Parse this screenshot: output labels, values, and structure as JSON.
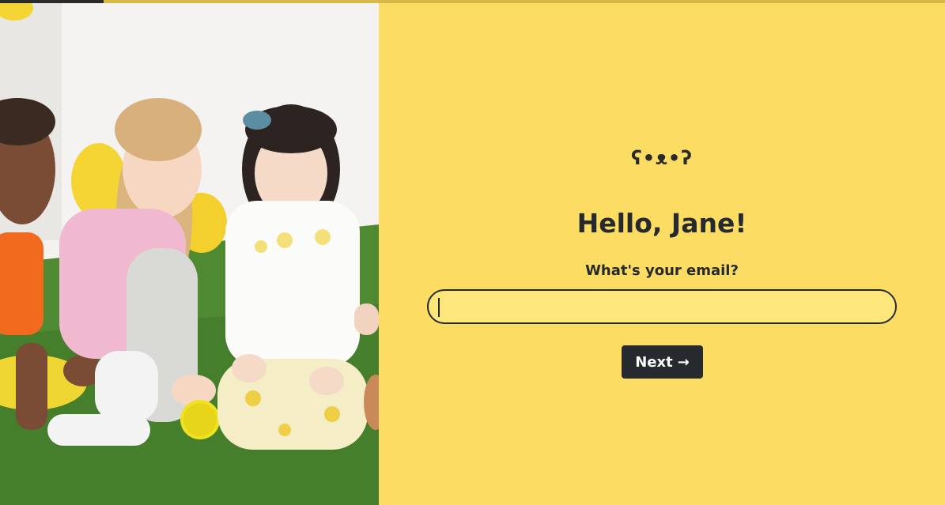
{
  "progress": {
    "fraction": 0.11
  },
  "logo": {
    "text": "ʕ•ᴥ•ʔ"
  },
  "greeting": "Hello, Jane!",
  "question": "What's your email?",
  "email": {
    "value": "",
    "placeholder": ""
  },
  "next": {
    "label": "Next",
    "arrow": "→"
  },
  "colors": {
    "background": "#fcdc62",
    "text": "#26292e",
    "input_bg": "#fde67a",
    "button_bg": "#26292e",
    "button_text": "#ffffff"
  },
  "photo": {
    "subject": "children-playing-with-yellow-balls-icon"
  }
}
